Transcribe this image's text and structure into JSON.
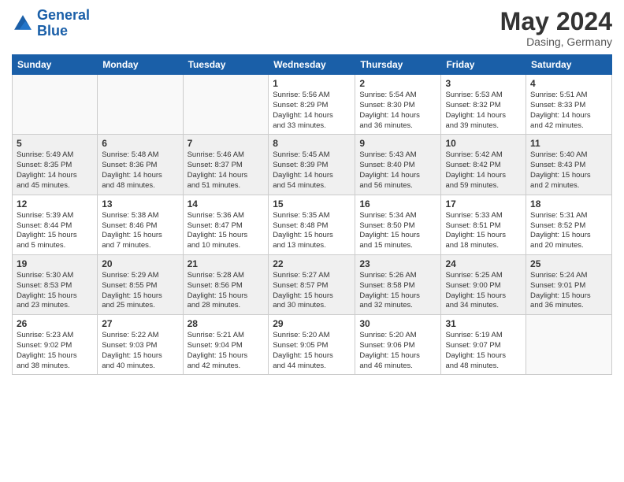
{
  "header": {
    "logo_line1": "General",
    "logo_line2": "Blue",
    "month": "May 2024",
    "location": "Dasing, Germany"
  },
  "days_of_week": [
    "Sunday",
    "Monday",
    "Tuesday",
    "Wednesday",
    "Thursday",
    "Friday",
    "Saturday"
  ],
  "weeks": [
    [
      {
        "num": "",
        "info": ""
      },
      {
        "num": "",
        "info": ""
      },
      {
        "num": "",
        "info": ""
      },
      {
        "num": "1",
        "info": "Sunrise: 5:56 AM\nSunset: 8:29 PM\nDaylight: 14 hours\nand 33 minutes."
      },
      {
        "num": "2",
        "info": "Sunrise: 5:54 AM\nSunset: 8:30 PM\nDaylight: 14 hours\nand 36 minutes."
      },
      {
        "num": "3",
        "info": "Sunrise: 5:53 AM\nSunset: 8:32 PM\nDaylight: 14 hours\nand 39 minutes."
      },
      {
        "num": "4",
        "info": "Sunrise: 5:51 AM\nSunset: 8:33 PM\nDaylight: 14 hours\nand 42 minutes."
      }
    ],
    [
      {
        "num": "5",
        "info": "Sunrise: 5:49 AM\nSunset: 8:35 PM\nDaylight: 14 hours\nand 45 minutes."
      },
      {
        "num": "6",
        "info": "Sunrise: 5:48 AM\nSunset: 8:36 PM\nDaylight: 14 hours\nand 48 minutes."
      },
      {
        "num": "7",
        "info": "Sunrise: 5:46 AM\nSunset: 8:37 PM\nDaylight: 14 hours\nand 51 minutes."
      },
      {
        "num": "8",
        "info": "Sunrise: 5:45 AM\nSunset: 8:39 PM\nDaylight: 14 hours\nand 54 minutes."
      },
      {
        "num": "9",
        "info": "Sunrise: 5:43 AM\nSunset: 8:40 PM\nDaylight: 14 hours\nand 56 minutes."
      },
      {
        "num": "10",
        "info": "Sunrise: 5:42 AM\nSunset: 8:42 PM\nDaylight: 14 hours\nand 59 minutes."
      },
      {
        "num": "11",
        "info": "Sunrise: 5:40 AM\nSunset: 8:43 PM\nDaylight: 15 hours\nand 2 minutes."
      }
    ],
    [
      {
        "num": "12",
        "info": "Sunrise: 5:39 AM\nSunset: 8:44 PM\nDaylight: 15 hours\nand 5 minutes."
      },
      {
        "num": "13",
        "info": "Sunrise: 5:38 AM\nSunset: 8:46 PM\nDaylight: 15 hours\nand 7 minutes."
      },
      {
        "num": "14",
        "info": "Sunrise: 5:36 AM\nSunset: 8:47 PM\nDaylight: 15 hours\nand 10 minutes."
      },
      {
        "num": "15",
        "info": "Sunrise: 5:35 AM\nSunset: 8:48 PM\nDaylight: 15 hours\nand 13 minutes."
      },
      {
        "num": "16",
        "info": "Sunrise: 5:34 AM\nSunset: 8:50 PM\nDaylight: 15 hours\nand 15 minutes."
      },
      {
        "num": "17",
        "info": "Sunrise: 5:33 AM\nSunset: 8:51 PM\nDaylight: 15 hours\nand 18 minutes."
      },
      {
        "num": "18",
        "info": "Sunrise: 5:31 AM\nSunset: 8:52 PM\nDaylight: 15 hours\nand 20 minutes."
      }
    ],
    [
      {
        "num": "19",
        "info": "Sunrise: 5:30 AM\nSunset: 8:53 PM\nDaylight: 15 hours\nand 23 minutes."
      },
      {
        "num": "20",
        "info": "Sunrise: 5:29 AM\nSunset: 8:55 PM\nDaylight: 15 hours\nand 25 minutes."
      },
      {
        "num": "21",
        "info": "Sunrise: 5:28 AM\nSunset: 8:56 PM\nDaylight: 15 hours\nand 28 minutes."
      },
      {
        "num": "22",
        "info": "Sunrise: 5:27 AM\nSunset: 8:57 PM\nDaylight: 15 hours\nand 30 minutes."
      },
      {
        "num": "23",
        "info": "Sunrise: 5:26 AM\nSunset: 8:58 PM\nDaylight: 15 hours\nand 32 minutes."
      },
      {
        "num": "24",
        "info": "Sunrise: 5:25 AM\nSunset: 9:00 PM\nDaylight: 15 hours\nand 34 minutes."
      },
      {
        "num": "25",
        "info": "Sunrise: 5:24 AM\nSunset: 9:01 PM\nDaylight: 15 hours\nand 36 minutes."
      }
    ],
    [
      {
        "num": "26",
        "info": "Sunrise: 5:23 AM\nSunset: 9:02 PM\nDaylight: 15 hours\nand 38 minutes."
      },
      {
        "num": "27",
        "info": "Sunrise: 5:22 AM\nSunset: 9:03 PM\nDaylight: 15 hours\nand 40 minutes."
      },
      {
        "num": "28",
        "info": "Sunrise: 5:21 AM\nSunset: 9:04 PM\nDaylight: 15 hours\nand 42 minutes."
      },
      {
        "num": "29",
        "info": "Sunrise: 5:20 AM\nSunset: 9:05 PM\nDaylight: 15 hours\nand 44 minutes."
      },
      {
        "num": "30",
        "info": "Sunrise: 5:20 AM\nSunset: 9:06 PM\nDaylight: 15 hours\nand 46 minutes."
      },
      {
        "num": "31",
        "info": "Sunrise: 5:19 AM\nSunset: 9:07 PM\nDaylight: 15 hours\nand 48 minutes."
      },
      {
        "num": "",
        "info": ""
      }
    ]
  ]
}
